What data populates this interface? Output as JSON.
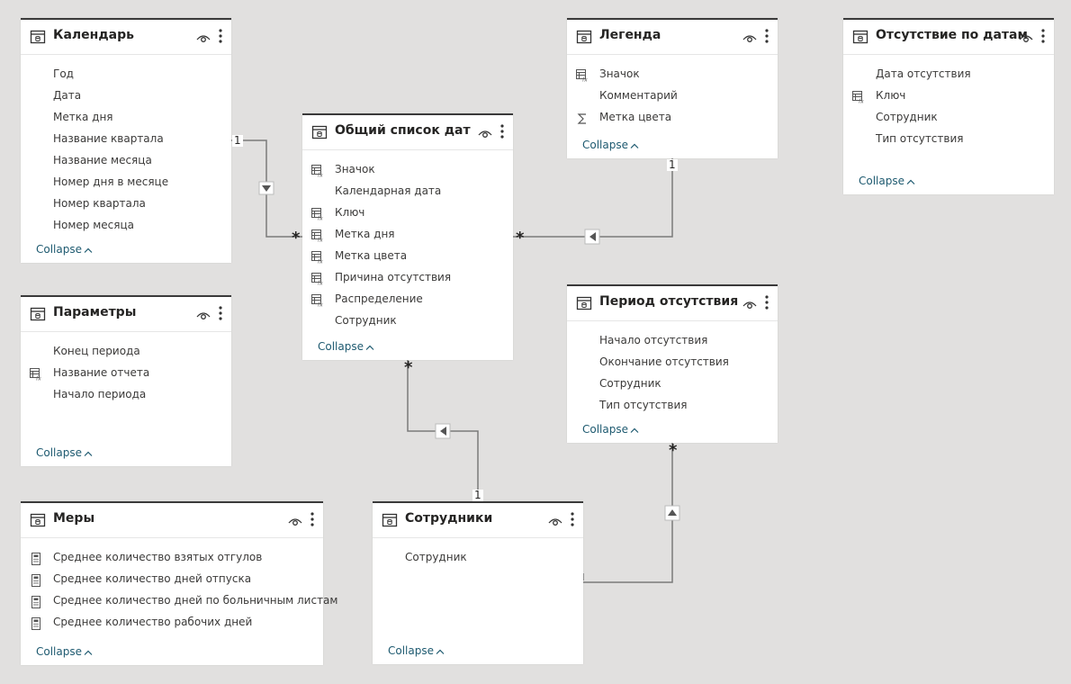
{
  "tables": {
    "calendar": {
      "title": "Календарь",
      "fields": [
        "Год",
        "Дата",
        "Метка дня",
        "Название квартала",
        "Название месяца",
        "Номер дня в месяце",
        "Номер квартала",
        "Номер месяца"
      ],
      "collapse": "Collapse"
    },
    "params": {
      "title": "Параметры",
      "fields": [
        "Конец периода",
        "Название отчета",
        "Начало периода"
      ],
      "collapse": "Collapse"
    },
    "measures": {
      "title": "Меры",
      "fields": [
        "Среднее количество взятых отгулов",
        "Среднее количество дней отпуска",
        "Среднее количество дней по больничным листам",
        "Среднее количество рабочих дней"
      ],
      "collapse": "Collapse"
    },
    "dates": {
      "title": "Общий список дат",
      "fields": [
        "Значок",
        "Календарная дата",
        "Ключ",
        "Метка дня",
        "Метка цвета",
        "Причина отсутствия",
        "Распределение",
        "Сотрудник"
      ],
      "collapse": "Collapse"
    },
    "legend": {
      "title": "Легенда",
      "fields": [
        "Значок",
        "Комментарий",
        "Метка цвета"
      ],
      "collapse": "Collapse"
    },
    "absdates": {
      "title": "Отсутствие по датам",
      "fields": [
        "Дата отсутствия",
        "Ключ",
        "Сотрудник",
        "Тип отсутствия"
      ],
      "collapse": "Collapse"
    },
    "period": {
      "title": "Период отсутствия",
      "fields": [
        "Начало отсутствия",
        "Окончание отсутствия",
        "Сотрудник",
        "Тип отсутствия"
      ],
      "collapse": "Collapse"
    },
    "employees": {
      "title": "Сотрудники",
      "fields": [
        "Сотрудник"
      ],
      "collapse": "Collapse"
    }
  },
  "cardinality": {
    "one": "1",
    "many": "*"
  },
  "colors": {
    "line": "#7a7a7a",
    "link": "#1e5a70",
    "background": "#e1e0df"
  }
}
